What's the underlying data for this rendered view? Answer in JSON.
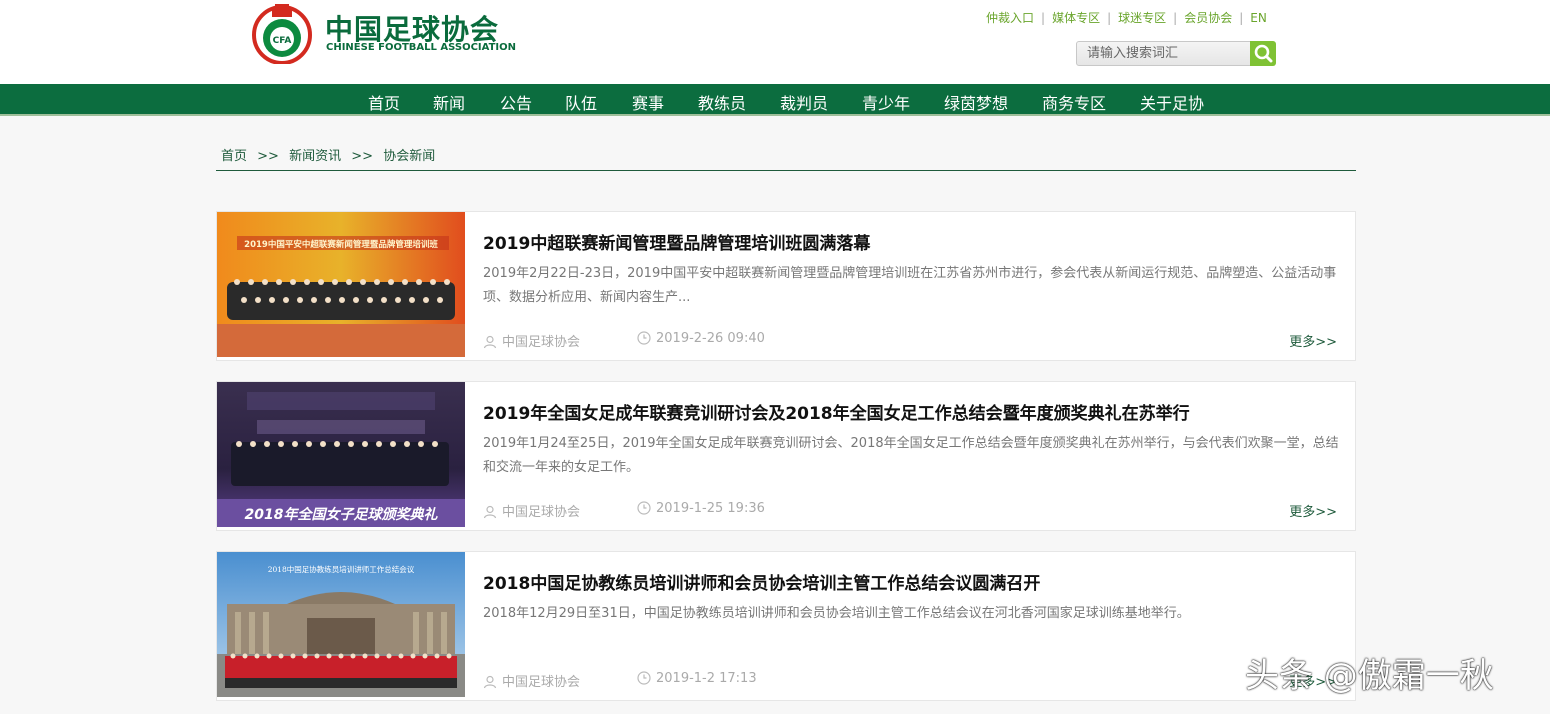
{
  "logo": {
    "cn": "中国足球协会",
    "en": "CHINESE FOOTBALL ASSOCIATION",
    "badge": "CFA",
    "badge_arc": "中国足球协会"
  },
  "toplinks": [
    "仲裁入口",
    "媒体专区",
    "球迷专区",
    "会员协会",
    "EN"
  ],
  "search": {
    "placeholder": "请输入搜索词汇"
  },
  "nav": [
    "首页",
    "新闻",
    "公告",
    "队伍",
    "赛事",
    "教练员",
    "裁判员",
    "青少年",
    "绿茵梦想",
    "商务专区",
    "关于足协"
  ],
  "breadcrumb": {
    "home": "首页",
    "sep": ">>",
    "level1": "新闻资讯",
    "level2": "协会新闻"
  },
  "articles": [
    {
      "title": "2019中超联赛新闻管理暨品牌管理培训班圆满落幕",
      "summary": "2019年2月22日-23日，2019中国平安中超联赛新闻管理暨品牌管理培训班在江苏省苏州市进行，参会代表从新闻运行规范、品牌塑造、公益活动事项、数据分析应用、新闻内容生产...",
      "author": "中国足球协会",
      "date": "2019-2-26 09:40",
      "more": "更多>>",
      "image_banner": "2019中国平安中超联赛新闻管理暨品牌管理培训班"
    },
    {
      "title": "2019年全国女足成年联赛竞训研讨会及2018年全国女足工作总结会暨年度颁奖典礼在苏举行",
      "summary": "2019年1月24至25日，2019年全国女足成年联赛竞训研讨会、2018年全国女足工作总结会暨年度颁奖典礼在苏州举行，与会代表们欢聚一堂，总结和交流一年来的女足工作。",
      "author": "中国足球协会",
      "date": "2019-1-25 19:36",
      "more": "更多>>",
      "image_banner": "2018年全国女子足球颁奖典礼"
    },
    {
      "title": "2018中国足协教练员培训讲师和会员协会培训主管工作总结会议圆满召开",
      "summary": "2018年12月29日至31日，中国足协教练员培训讲师和会员协会培训主管工作总结会议在河北香河国家足球训练基地举行。",
      "author": "中国足球协会",
      "date": "2019-1-2 17:13",
      "more": "更多>>",
      "image_banner": "2018中国足协教练员培训讲师工作总结会议"
    }
  ],
  "watermark": "头条 @傲霜一秋",
  "colors": {
    "brand_green": "#0c6d3f",
    "link_green": "#6aa52c",
    "search_button": "#7fc234"
  }
}
